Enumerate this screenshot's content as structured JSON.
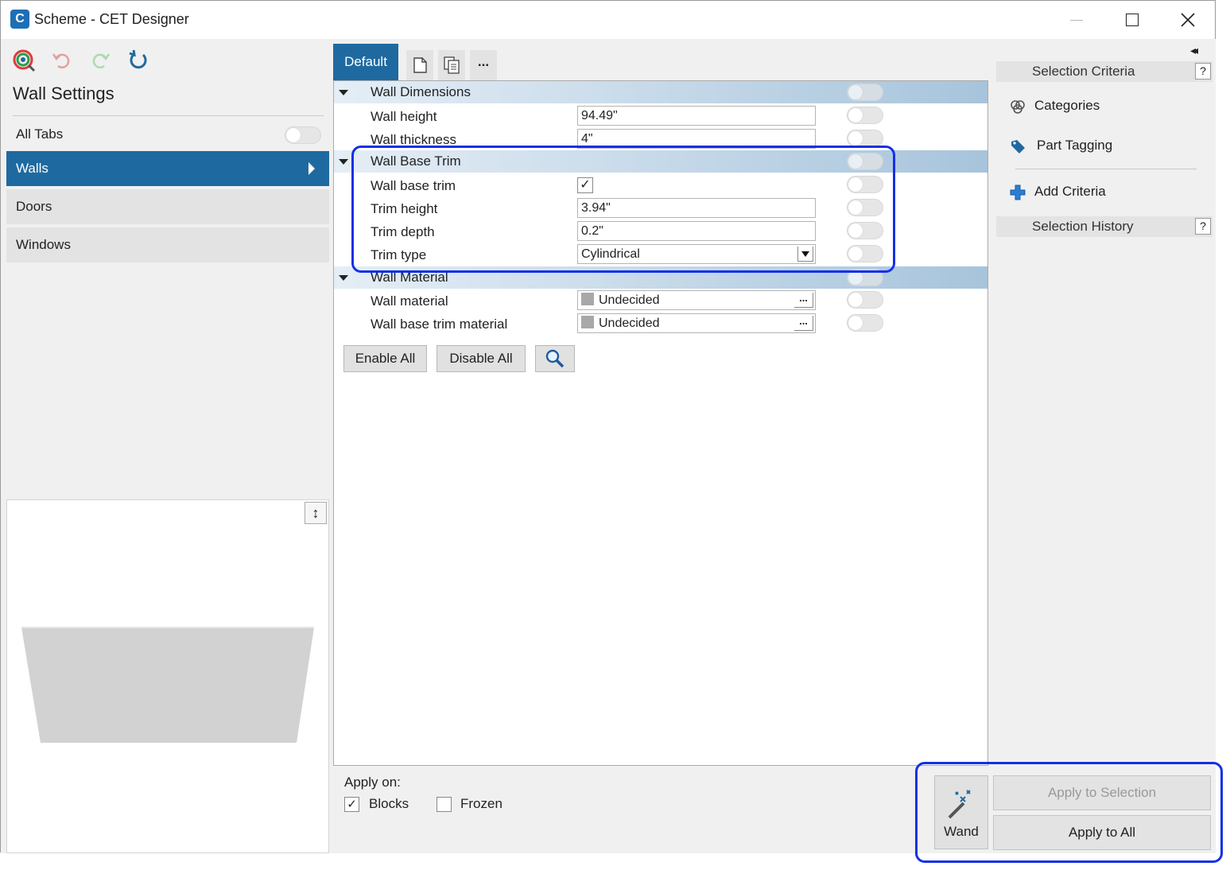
{
  "window": {
    "title": "Scheme - CET Designer"
  },
  "left": {
    "heading": "Wall Settings",
    "all_tabs_label": "All Tabs",
    "nav": [
      {
        "label": "Walls",
        "active": true
      },
      {
        "label": "Doors",
        "active": false
      },
      {
        "label": "Windows",
        "active": false
      }
    ]
  },
  "center": {
    "tab_default": "Default",
    "more_label": "...",
    "groups": {
      "dimensions": {
        "title": "Wall Dimensions",
        "wall_height_label": "Wall height",
        "wall_height_value": "94.49\"",
        "wall_thickness_label": "Wall thickness",
        "wall_thickness_value": "4\""
      },
      "base_trim": {
        "title": "Wall Base Trim",
        "base_trim_label": "Wall base trim",
        "base_trim_checked": true,
        "trim_height_label": "Trim height",
        "trim_height_value": "3.94\"",
        "trim_depth_label": "Trim depth",
        "trim_depth_value": "0.2\"",
        "trim_type_label": "Trim type",
        "trim_type_value": "Cylindrical"
      },
      "material": {
        "title": "Wall Material",
        "wall_material_label": "Wall material",
        "wall_material_value": "Undecided",
        "base_trim_material_label": "Wall base trim material",
        "base_trim_material_value": "Undecided",
        "ellipsis": "..."
      }
    },
    "enable_all": "Enable All",
    "disable_all": "Disable All",
    "apply_on_label": "Apply on:",
    "blocks_label": "Blocks",
    "frozen_label": "Frozen"
  },
  "right": {
    "selection_criteria": "Selection Criteria",
    "categories": "Categories",
    "part_tagging": "Part Tagging",
    "add_criteria": "Add Criteria",
    "selection_history": "Selection History",
    "help": "?",
    "collapse": "◂◂",
    "wand_label": "Wand",
    "apply_selection": "Apply to Selection",
    "apply_all": "Apply to All"
  },
  "colors": {
    "accent": "#1e6aa0",
    "highlight": "#1430e6"
  }
}
